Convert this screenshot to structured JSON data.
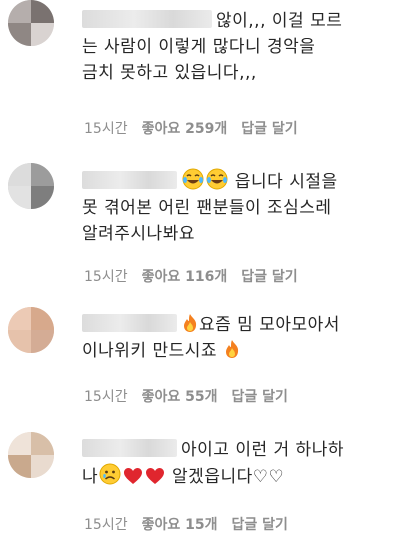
{
  "comments": [
    {
      "text_lines": [
        "않이,,, 이걸 모르",
        "는 사람이 이렇게 많다니 경악을",
        "금치 못하고 있읍니다,,,"
      ],
      "time": "15시간",
      "likes": "좋아요 259개",
      "reply": "답글 달기"
    },
    {
      "text_lines": [
        "읍니다 시절을",
        "못 겪어본 어린 팬분들이 조심스레",
        "알려주시나봐요"
      ],
      "time": "15시간",
      "likes": "좋아요 116개",
      "reply": "답글 달기"
    },
    {
      "text_lines": [
        "요즘 밈 모아모아서",
        "이나위키 만드시죠"
      ],
      "time": "15시간",
      "likes": "좋아요 55개",
      "reply": "답글 달기"
    },
    {
      "text_lines": [
        "아이고 이런 거 하나하",
        "나",
        "알겠읍니다♡♡"
      ],
      "time": "15시간",
      "likes": "좋아요 15개",
      "reply": "답글 달기"
    }
  ],
  "icons": [
    "blurred-avatar",
    "tears-of-joy-emoji",
    "fire-emoji",
    "sad-face-emoji",
    "red-heart-emoji"
  ],
  "colors": {
    "text": "#262626",
    "meta": "#8e8e8e",
    "heart": "#e0262e",
    "fire": "#f4801f"
  }
}
